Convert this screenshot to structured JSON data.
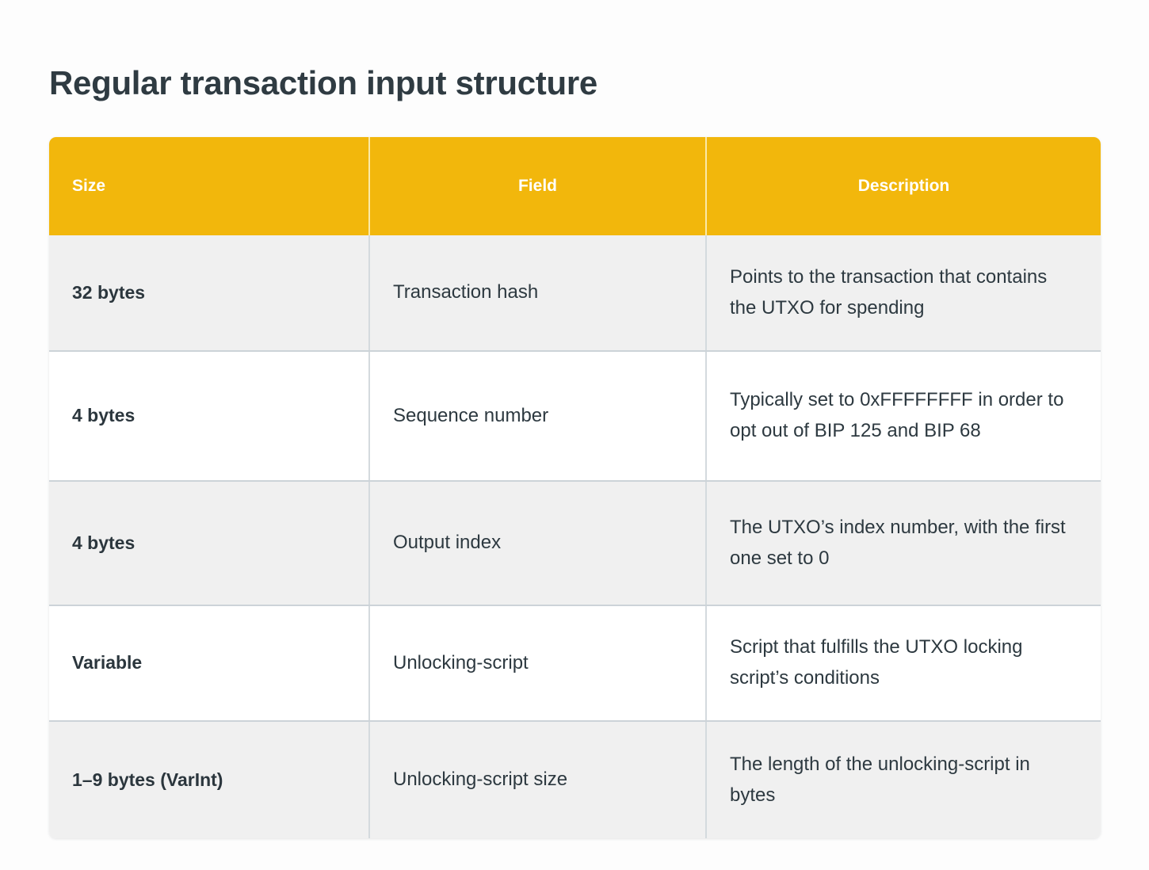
{
  "document": {
    "title": "Regular transaction input structure"
  },
  "theme": {
    "header_background": "#f2b70c",
    "header_text": "#ffffff",
    "stripe_background": "#f0f0f0",
    "plain_background": "#ffffff",
    "body_text": "#2d3940",
    "border": "#ccd3d8",
    "page_background": "#fdfdfd"
  },
  "table": {
    "columns": [
      {
        "label": "Size",
        "align": "left"
      },
      {
        "label": "Field",
        "align": "center"
      },
      {
        "label": "Description",
        "align": "center"
      }
    ],
    "rows": [
      {
        "size": "32 bytes",
        "field": "Transaction hash",
        "description": "Points to the transaction that contains the UTXO for spending"
      },
      {
        "size": "4 bytes",
        "field": "Sequence number",
        "description": "Typically set to 0xFFFFFFFF in order to opt out of BIP 125 and BIP 68"
      },
      {
        "size": "4 bytes",
        "field": "Output index",
        "description": "The UTXO’s index number, with the first one set to 0"
      },
      {
        "size": "Variable",
        "field": "Unlocking-script",
        "description": "Script that fulfills the UTXO locking script’s conditions"
      },
      {
        "size": "1–9 bytes (VarInt)",
        "field": "Unlocking-script size",
        "description": "The length of the unlocking-script in bytes"
      }
    ]
  }
}
